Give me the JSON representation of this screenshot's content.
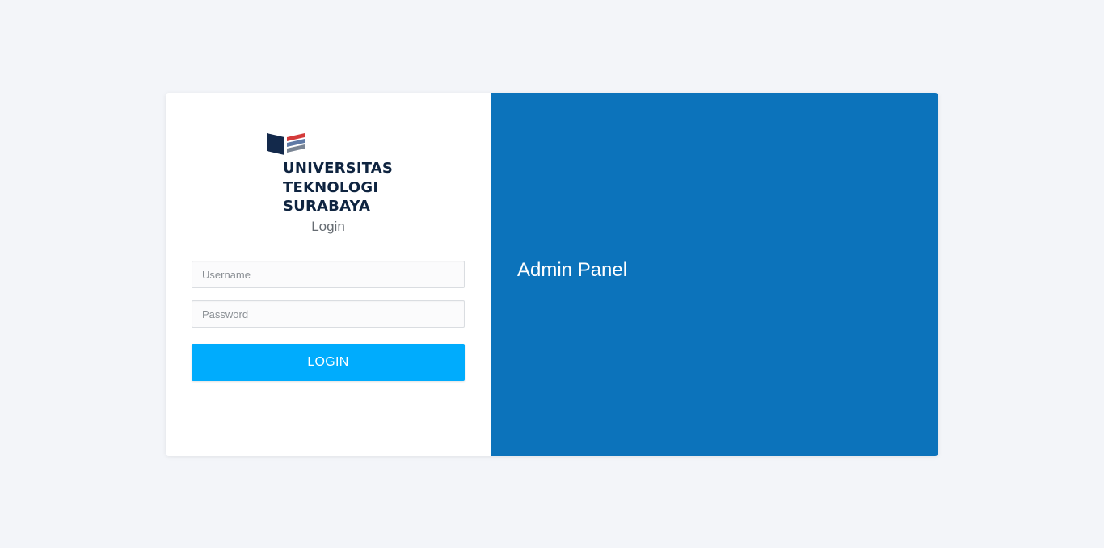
{
  "brand": {
    "name_lines": [
      "UNIVERSITAS",
      "TEKNOLOGI",
      "SURABAYA"
    ],
    "logo_icon": "university-book-logo-icon",
    "colors": {
      "navy": "#13294b",
      "red": "#d43a3a",
      "gray": "#7a8594"
    }
  },
  "login": {
    "heading": "Login",
    "username_placeholder": "Username",
    "password_placeholder": "Password",
    "button_label": "LOGIN"
  },
  "side_panel": {
    "title": "Admin Panel",
    "background": "#0c73bb"
  },
  "colors": {
    "page_background": "#f3f5f9",
    "button": "#00acfd"
  }
}
